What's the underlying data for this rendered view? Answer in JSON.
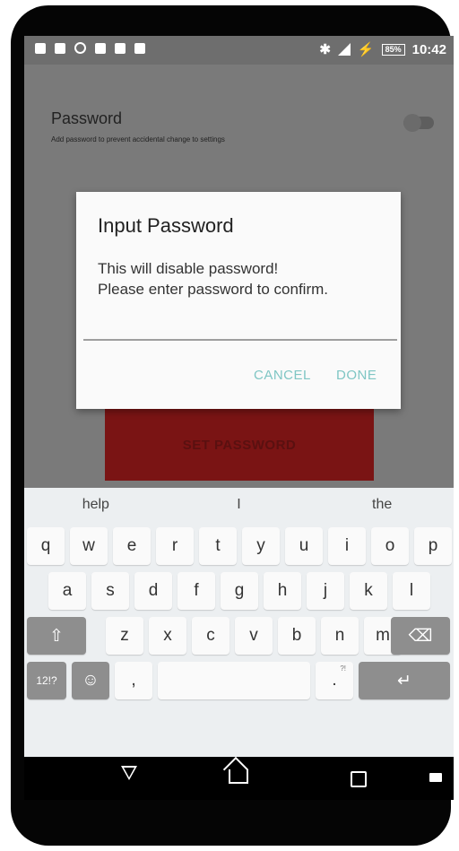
{
  "status_bar": {
    "left_icons": [
      "usb-icon",
      "screenshot-icon",
      "alarm-icon",
      "voicemail-icon",
      "message-icon",
      "download-icon"
    ],
    "battery": "85%",
    "time": "10:42"
  },
  "settings": {
    "title": "Password",
    "description": "Add password to prevent accidental change to settings",
    "toggle_state": "off",
    "button_label": "SET PASSWORD"
  },
  "dialog": {
    "title": "Input Password",
    "message": "This will disable password!\nPlease enter password to confirm.",
    "input_value": "",
    "cancel_label": "CANCEL",
    "done_label": "DONE",
    "accent_color": "#7fc6c4"
  },
  "keyboard": {
    "suggestions": [
      "help",
      "I",
      "the"
    ],
    "row1": [
      "q",
      "w",
      "e",
      "r",
      "t",
      "y",
      "u",
      "i",
      "o",
      "p"
    ],
    "row2": [
      "a",
      "s",
      "d",
      "f",
      "g",
      "h",
      "j",
      "k",
      "l"
    ],
    "row3": [
      "z",
      "x",
      "c",
      "v",
      "b",
      "n",
      "m"
    ],
    "symbols_key": "12!?",
    "comma_key": ",",
    "period_key": ".",
    "period_hint": "?!"
  },
  "nav_bar": {
    "icons": [
      "back-icon",
      "home-icon",
      "recents-icon",
      "keyboard-switch-icon"
    ]
  }
}
